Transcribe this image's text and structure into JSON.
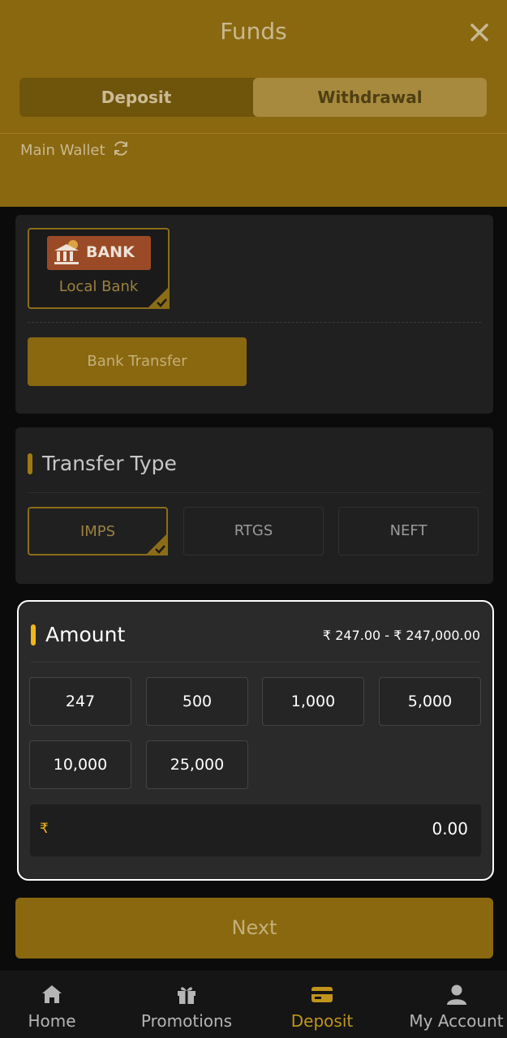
{
  "header": {
    "title": "Funds",
    "tabs": {
      "deposit": "Deposit",
      "withdrawal": "Withdrawal"
    },
    "wallet_label": "Main Wallet"
  },
  "payment_method": {
    "bank_logo_text": "BANK",
    "bank_name": "Local Bank",
    "transfer_button": "Bank Transfer"
  },
  "transfer_type": {
    "title": "Transfer Type",
    "options": [
      "IMPS",
      "RTGS",
      "NEFT"
    ],
    "selected": "IMPS"
  },
  "amount": {
    "title": "Amount",
    "range": "₹ 247.00 - ₹ 247,000.00",
    "quick_amounts": [
      "247",
      "500",
      "1,000",
      "5,000",
      "10,000",
      "25,000"
    ],
    "currency_symbol": "₹",
    "input_value": "0.00"
  },
  "next_button": "Next",
  "bottom_nav": {
    "items": [
      {
        "label": "Home",
        "icon": "home-icon"
      },
      {
        "label": "Promotions",
        "icon": "gift-icon"
      },
      {
        "label": "Deposit",
        "icon": "card-icon"
      },
      {
        "label": "My Account",
        "icon": "user-icon"
      }
    ],
    "active": "Deposit"
  },
  "colors": {
    "gold": "#f0b71a",
    "gold_dim": "#8a6810",
    "panel": "#202020"
  }
}
